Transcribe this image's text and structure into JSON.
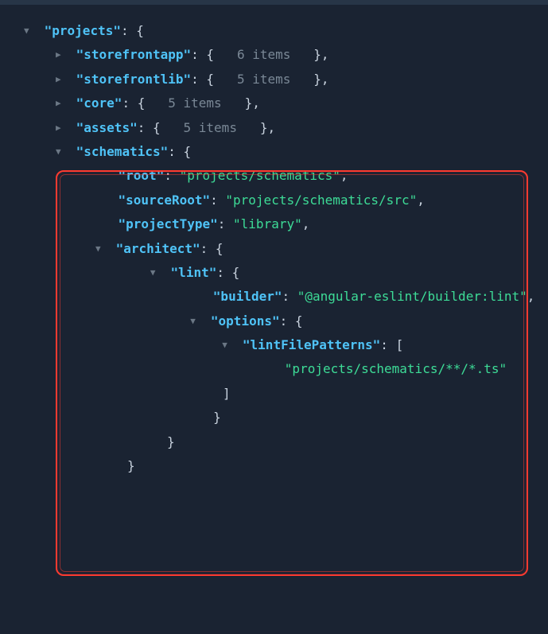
{
  "root_key": "\"projects\"",
  "collapsed": [
    {
      "key": "\"storefrontapp\"",
      "count": "6 items"
    },
    {
      "key": "\"storefrontlib\"",
      "count": "5 items"
    },
    {
      "key": "\"core\"",
      "count": "5 items"
    },
    {
      "key": "\"assets\"",
      "count": "5 items"
    }
  ],
  "schematics": {
    "key": "\"schematics\"",
    "root_key": "\"root\"",
    "root_val": "\"projects/schematics\"",
    "sourceRoot_key": "\"sourceRoot\"",
    "sourceRoot_val": "\"projects/schematics/src\"",
    "projectType_key": "\"projectType\"",
    "projectType_val": "\"library\"",
    "architect_key": "\"architect\"",
    "lint_key": "\"lint\"",
    "builder_key": "\"builder\"",
    "builder_val": "\"@angular-eslint/builder:lint\"",
    "options_key": "\"options\"",
    "lintFilePatterns_key": "\"lintFilePatterns\"",
    "lintFilePatterns_val": "\"projects/schematics/**/*.ts\""
  },
  "punct": {
    "colon_brace": ": {",
    "colon_bracket": ": [",
    "colon": ": ",
    "open_brace": "{",
    "close_brace": "}",
    "close_brace_comma": "},",
    "close_bracket": "]",
    "comma": ","
  }
}
